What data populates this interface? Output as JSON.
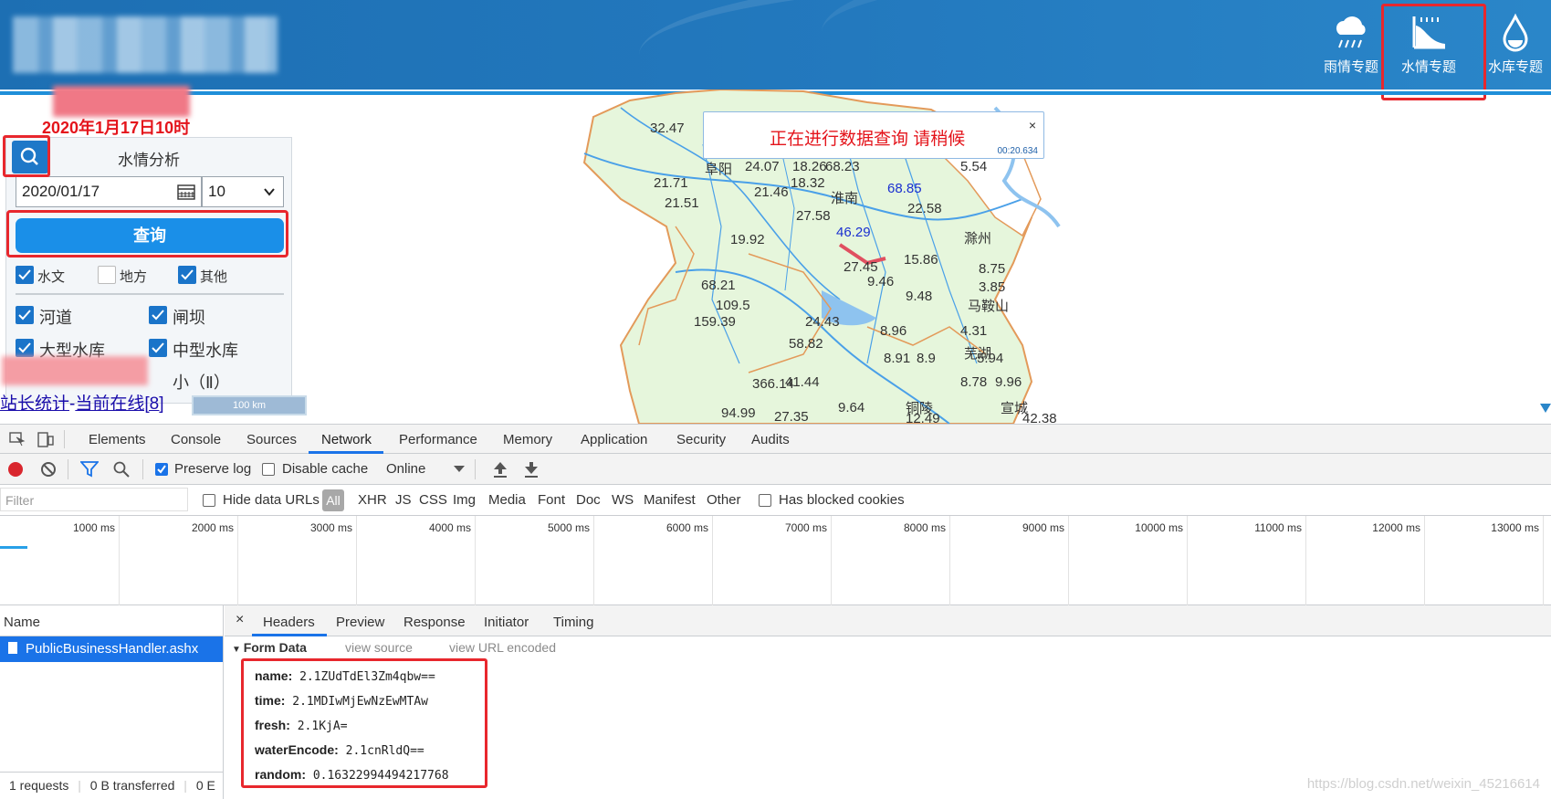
{
  "banner": {
    "topics": [
      {
        "label": "雨情专题",
        "icon": "cloud-rain-icon"
      },
      {
        "label": "水情专题",
        "icon": "water-level-icon"
      },
      {
        "label": "水库专题",
        "icon": "water-drop-icon"
      }
    ]
  },
  "date_title": "2020年1月17日10时",
  "panel": {
    "title": "水情分析",
    "date_value": "2020/01/17",
    "hour_value": "10",
    "query_label": "查询",
    "type_checks": [
      {
        "label": "水文",
        "checked": true
      },
      {
        "label": "地方",
        "checked": false
      },
      {
        "label": "其他",
        "checked": true
      }
    ],
    "layer_checks": [
      {
        "label": "河道",
        "checked": true
      },
      {
        "label": "闸坝",
        "checked": true
      },
      {
        "label": "大型水库",
        "checked": true
      },
      {
        "label": "中型水库",
        "checked": true
      }
    ],
    "partial_label": "小（Ⅱ）"
  },
  "links": {
    "stats": "站长统计",
    "sep": "-",
    "online": "当前在线[8]"
  },
  "scale": "100 km",
  "toast": {
    "message": "正在进行数据查询 请稍候",
    "close": "×",
    "time": "00:20.634"
  },
  "map_labels": [
    {
      "text": "32.47"
    },
    {
      "text": "阜阳"
    },
    {
      "text": "24.07"
    },
    {
      "text": "18.26"
    },
    {
      "text": "68.23"
    },
    {
      "text": "68.85",
      "blue": true
    },
    {
      "text": "21.71"
    },
    {
      "text": "21.46"
    },
    {
      "text": "18.32"
    },
    {
      "text": "淮南"
    },
    {
      "text": "21.51"
    },
    {
      "text": "22.58"
    },
    {
      "text": "5.54"
    },
    {
      "text": "27.58"
    },
    {
      "text": "46.29",
      "blue": true
    },
    {
      "text": "19.92"
    },
    {
      "text": "滁州"
    },
    {
      "text": "27.45"
    },
    {
      "text": "15.86"
    },
    {
      "text": "8.75"
    },
    {
      "text": "68.21"
    },
    {
      "text": "9.46"
    },
    {
      "text": "3.85"
    },
    {
      "text": "109.5"
    },
    {
      "text": "9.48"
    },
    {
      "text": "马鞍山"
    },
    {
      "text": "159.39"
    },
    {
      "text": "24.43"
    },
    {
      "text": "8.96"
    },
    {
      "text": "4.31"
    },
    {
      "text": "芜湖"
    },
    {
      "text": "58.82"
    },
    {
      "text": "8.91"
    },
    {
      "text": "8.9"
    },
    {
      "text": "5.94"
    },
    {
      "text": "366.14"
    },
    {
      "text": "41.44"
    },
    {
      "text": "8.78"
    },
    {
      "text": "9.96"
    },
    {
      "text": "9.64"
    },
    {
      "text": "铜陵"
    },
    {
      "text": "宣城"
    },
    {
      "text": "94.99"
    },
    {
      "text": "27.35"
    },
    {
      "text": "12.49"
    },
    {
      "text": "42.38"
    }
  ],
  "devtools": {
    "tabs": [
      "Elements",
      "Console",
      "Sources",
      "Network",
      "Performance",
      "Memory",
      "Application",
      "Security",
      "Audits"
    ],
    "preserve_log": "Preserve log",
    "disable_cache": "Disable cache",
    "throttle": "Online",
    "filter_placeholder": "Filter",
    "hide_data_urls": "Hide data URLs",
    "types": [
      "All",
      "XHR",
      "JS",
      "CSS",
      "Img",
      "Media",
      "Font",
      "Doc",
      "WS",
      "Manifest",
      "Other"
    ],
    "has_blocked": "Has blocked cookies",
    "ticks": [
      "1000 ms",
      "2000 ms",
      "3000 ms",
      "4000 ms",
      "5000 ms",
      "6000 ms",
      "7000 ms",
      "8000 ms",
      "9000 ms",
      "10000 ms",
      "11000 ms",
      "12000 ms",
      "13000 ms"
    ],
    "name_header": "Name",
    "request": "PublicBusinessHandler.ashx",
    "status": {
      "requests": "1 requests",
      "transferred": "0 B transferred",
      "more": "0 E"
    },
    "detail_close": "×",
    "detail_tabs": [
      "Headers",
      "Preview",
      "Response",
      "Initiator",
      "Timing"
    ],
    "form_data_title": "Form Data",
    "view_source": "view source",
    "view_url": "view URL encoded",
    "form_rows": [
      {
        "key": "name:",
        "value": "2.1ZUdTdEl3Zm4qbw=="
      },
      {
        "key": "time:",
        "value": "2.1MDIwMjEwNzEwMTAw"
      },
      {
        "key": "fresh:",
        "value": "2.1KjA="
      },
      {
        "key": "waterEncode:",
        "value": "2.1cnRldQ=="
      },
      {
        "key": "random:",
        "value": "0.16322994494217768"
      }
    ],
    "watermark": "https://blog.csdn.net/weixin_45216614"
  }
}
